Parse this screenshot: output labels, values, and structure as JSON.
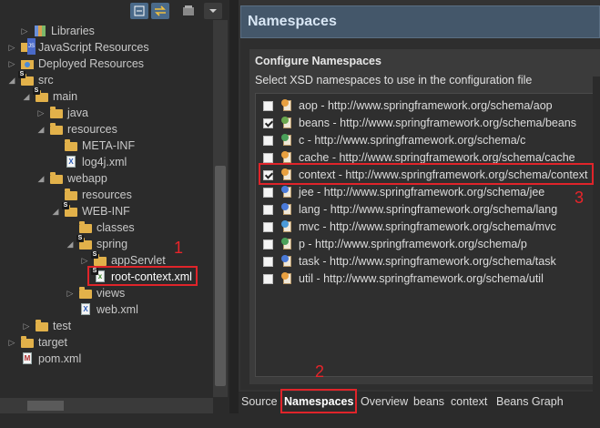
{
  "toolbar": {
    "buttons": [
      "collapse-all-icon",
      "link-with-editor-icon",
      "filters-icon",
      "view-menu-icon"
    ]
  },
  "tree": {
    "items": [
      {
        "label": "Libraries",
        "icon": "library-icon"
      },
      {
        "label": "JavaScript Resources",
        "icon": "js-resources-icon"
      },
      {
        "label": "Deployed Resources",
        "icon": "deployed-resources-icon"
      },
      {
        "label": "src",
        "icon": "folder-icon"
      },
      {
        "label": "main",
        "icon": "folder-icon"
      },
      {
        "label": "java",
        "icon": "folder-icon"
      },
      {
        "label": "resources",
        "icon": "folder-icon"
      },
      {
        "label": "META-INF",
        "icon": "folder-icon"
      },
      {
        "label": "log4j.xml",
        "icon": "xml-file-icon"
      },
      {
        "label": "webapp",
        "icon": "folder-icon"
      },
      {
        "label": "resources",
        "icon": "folder-icon"
      },
      {
        "label": "WEB-INF",
        "icon": "folder-icon"
      },
      {
        "label": "classes",
        "icon": "folder-icon"
      },
      {
        "label": "spring",
        "icon": "folder-icon"
      },
      {
        "label": "appServlet",
        "icon": "folder-icon"
      },
      {
        "label": "root-context.xml",
        "icon": "spring-xml-icon"
      },
      {
        "label": "views",
        "icon": "folder-icon"
      },
      {
        "label": "web.xml",
        "icon": "xml-file-icon"
      },
      {
        "label": "test",
        "icon": "folder-icon"
      },
      {
        "label": "target",
        "icon": "folder-icon"
      },
      {
        "label": "pom.xml",
        "icon": "maven-pom-icon"
      }
    ]
  },
  "editor": {
    "header_title": "Namespaces",
    "section_title": "Configure Namespaces",
    "section_desc": "Select XSD namespaces to use in the configuration file",
    "namespaces": [
      {
        "label": "aop - http://www.springframework.org/schema/aop",
        "checked": false,
        "icon": "aop-icon"
      },
      {
        "label": "beans - http://www.springframework.org/schema/beans",
        "checked": true,
        "icon": "beans-icon"
      },
      {
        "label": "c - http://www.springframework.org/schema/c",
        "checked": false,
        "icon": "c-namespace-icon"
      },
      {
        "label": "cache - http://www.springframework.org/schema/cache",
        "checked": false,
        "icon": "cache-icon"
      },
      {
        "label": "context - http://www.springframework.org/schema/context",
        "checked": true,
        "icon": "context-icon"
      },
      {
        "label": "jee - http://www.springframework.org/schema/jee",
        "checked": false,
        "icon": "jee-icon"
      },
      {
        "label": "lang - http://www.springframework.org/schema/lang",
        "checked": false,
        "icon": "lang-icon"
      },
      {
        "label": "mvc - http://www.springframework.org/schema/mvc",
        "checked": false,
        "icon": "mvc-icon"
      },
      {
        "label": "p - http://www.springframework.org/schema/p",
        "checked": false,
        "icon": "p-namespace-icon"
      },
      {
        "label": "task - http://www.springframework.org/schema/task",
        "checked": false,
        "icon": "task-icon"
      },
      {
        "label": "util - http://www.springframework.org/schema/util",
        "checked": false,
        "icon": "util-icon"
      }
    ]
  },
  "tabs": [
    "Source",
    "Namespaces",
    "Overview",
    "beans",
    "context",
    "Beans Graph"
  ],
  "active_tab": "Namespaces",
  "annotations": {
    "label1": "1",
    "label2": "2",
    "label3": "3"
  },
  "colors": {
    "annotation_red": "#e0242a",
    "header_blue": "#44576a",
    "folder_yellow": "#e2b14a"
  }
}
